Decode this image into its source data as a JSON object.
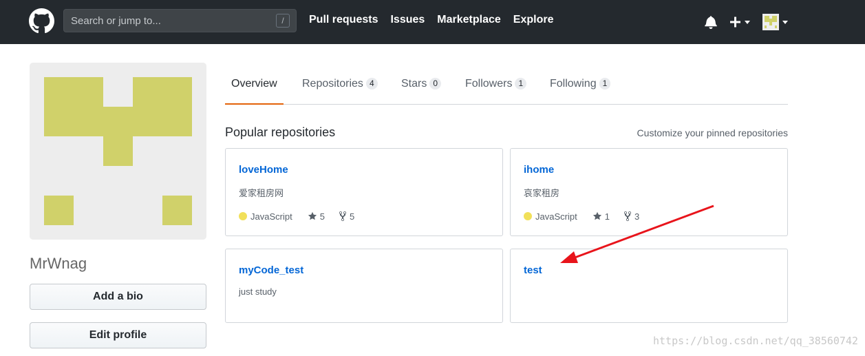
{
  "header": {
    "search_placeholder": "Search or jump to...",
    "search_shortcut": "/",
    "nav": [
      "Pull requests",
      "Issues",
      "Marketplace",
      "Explore"
    ],
    "icons": [
      "github-logo-icon",
      "bell-icon",
      "plus-icon",
      "chevron-down-icon"
    ]
  },
  "profile": {
    "username": "MrWnag",
    "add_bio_label": "Add a bio",
    "edit_profile_label": "Edit profile",
    "avatar_color": "#d0d16a"
  },
  "tabs": [
    {
      "label": "Overview",
      "count": null
    },
    {
      "label": "Repositories",
      "count": "4"
    },
    {
      "label": "Stars",
      "count": "0"
    },
    {
      "label": "Followers",
      "count": "1"
    },
    {
      "label": "Following",
      "count": "1"
    }
  ],
  "popular": {
    "title": "Popular repositories",
    "customize_label": "Customize your pinned repositories"
  },
  "repos": [
    {
      "name": "loveHome",
      "description": "爱家租房网",
      "language": "JavaScript",
      "stars": "5",
      "forks": "5"
    },
    {
      "name": "ihome",
      "description": "哀家租房",
      "language": "JavaScript",
      "stars": "1",
      "forks": "3"
    },
    {
      "name": "myCode_test",
      "description": "just study"
    },
    {
      "name": "test",
      "description": ""
    }
  ],
  "watermark": "https://blog.csdn.net/qq_38560742",
  "colors": {
    "header": "#24292e",
    "link": "#0366d6",
    "tab_underline": "#e36209",
    "javascript": "#f1e05a",
    "arrow": "#e8141b"
  }
}
